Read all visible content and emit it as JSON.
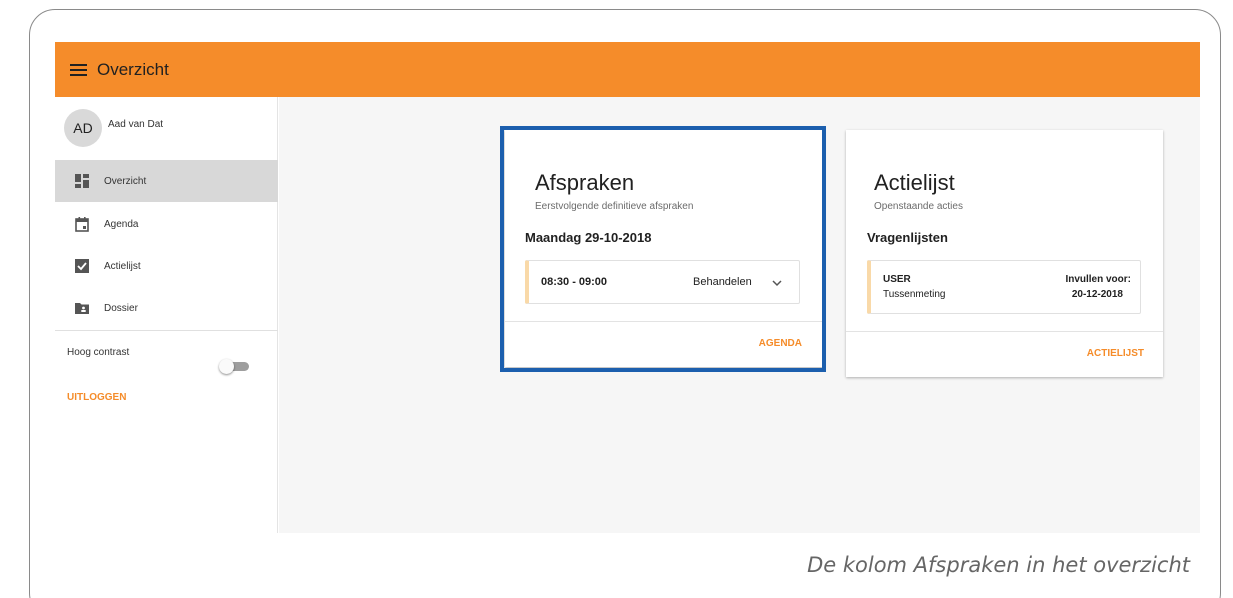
{
  "appbar": {
    "title": "Overzicht",
    "menu_icon": "menu-icon"
  },
  "colors": {
    "accent": "#f58c2a",
    "highlight": "#1c5fae",
    "item_border": "#f9d9a8"
  },
  "user": {
    "initials": "AD",
    "name": "Aad van Dat"
  },
  "sidebar": {
    "items": [
      {
        "label": "Overzicht",
        "icon": "dashboard-icon",
        "active": true
      },
      {
        "label": "Agenda",
        "icon": "calendar-icon",
        "active": false
      },
      {
        "label": "Actielijst",
        "icon": "checkbox-icon",
        "active": false
      },
      {
        "label": "Dossier",
        "icon": "folder-shared-icon",
        "active": false
      }
    ],
    "contrast_label": "Hoog contrast",
    "logout_label": "UITLOGGEN"
  },
  "cards": {
    "afspraken": {
      "title": "Afspraken",
      "subtitle": "Eerstvolgende definitieve afspraken",
      "date": "Maandag 29-10-2018",
      "time": "08:30 - 09:00",
      "type": "Behandelen",
      "action": "AGENDA"
    },
    "actielijst": {
      "title": "Actielijst",
      "subtitle": "Openstaande acties",
      "section": "Vragenlijsten",
      "who": "USER",
      "what": "Tussenmeting",
      "due_label": "Invullen voor:",
      "due_date": "20-12-2018",
      "action": "ACTIELIJST"
    }
  },
  "caption": "De kolom Afspraken in het overzicht"
}
